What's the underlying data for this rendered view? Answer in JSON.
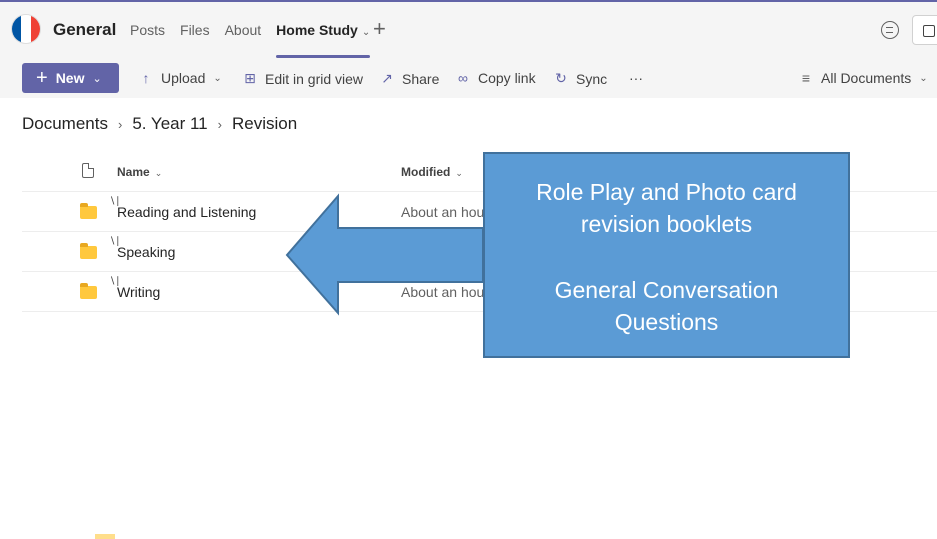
{
  "header": {
    "channel_title": "General",
    "tabs": [
      {
        "label": "Posts",
        "active": false
      },
      {
        "label": "Files",
        "active": false
      },
      {
        "label": "About",
        "active": false
      },
      {
        "label": "Home Study",
        "active": true
      }
    ],
    "accent_color": "#6264a7"
  },
  "toolbar": {
    "new_label": "New",
    "upload_label": "Upload",
    "grid_label": "Edit in grid view",
    "share_label": "Share",
    "copy_link_label": "Copy link",
    "sync_label": "Sync",
    "more_label": "···",
    "view_label": "All Documents"
  },
  "breadcrumb": {
    "items": [
      "Documents",
      "5. Year 11",
      "Revision"
    ]
  },
  "list": {
    "columns": {
      "name": "Name",
      "modified": "Modified"
    },
    "rows": [
      {
        "name": "Reading and Listening",
        "modified": "About an hour"
      },
      {
        "name": "Speaking",
        "modified": ""
      },
      {
        "name": "Writing",
        "modified": "About an hour"
      }
    ]
  },
  "callout": {
    "line1": "Role Play and Photo card",
    "line2": "revision booklets",
    "line3": "General Conversation",
    "line4": "Questions",
    "fill_color": "#5b9bd5"
  }
}
